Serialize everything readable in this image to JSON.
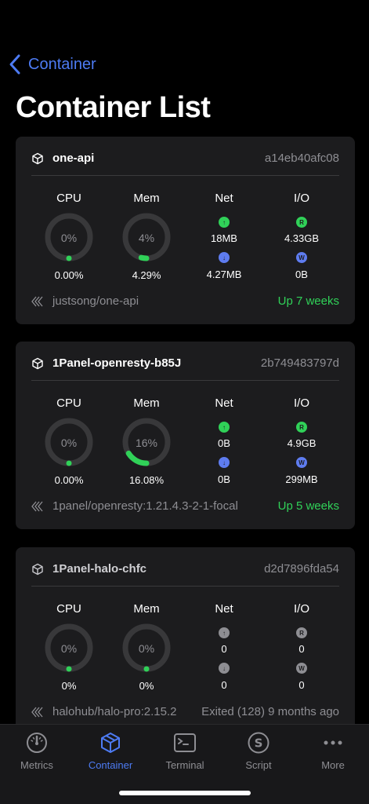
{
  "nav": {
    "back_label": "Container",
    "title": "Container List"
  },
  "column_labels": {
    "cpu": "CPU",
    "mem": "Mem",
    "net": "Net",
    "io": "I/O"
  },
  "io_badges": {
    "up": "↑",
    "down": "↓",
    "read": "R",
    "write": "W"
  },
  "colors": {
    "accent": "#4d7bf3",
    "green": "#30d158",
    "track": "#38383a",
    "muted": "#8e8e93",
    "up": "#30d158",
    "down": "#5e7cf0",
    "read": "#30d158",
    "write": "#5e7cf0",
    "inactive_badge": "#8e8e93"
  },
  "containers": [
    {
      "name": "one-api",
      "id": "a14eb40afc08",
      "cpu_pct_label": "0%",
      "cpu_fraction": 0.0,
      "cpu_value": "0.00%",
      "mem_pct_label": "4%",
      "mem_fraction": 0.04,
      "mem_value": "4.29%",
      "net_up": "18MB",
      "net_down": "4.27MB",
      "io_read": "4.33GB",
      "io_write": "0B",
      "image": "justsong/one-api",
      "status": "Up 7 weeks",
      "status_color": "#30d158",
      "active": true
    },
    {
      "name": "1Panel-openresty-b85J",
      "id": "2b749483797d",
      "cpu_pct_label": "0%",
      "cpu_fraction": 0.0,
      "cpu_value": "0.00%",
      "mem_pct_label": "16%",
      "mem_fraction": 0.16,
      "mem_value": "16.08%",
      "net_up": "0B",
      "net_down": "0B",
      "io_read": "4.9GB",
      "io_write": "299MB",
      "image": "1panel/openresty:1.21.4.3-2-1-focal",
      "status": "Up 5 weeks",
      "status_color": "#30d158",
      "active": true
    },
    {
      "name": "1Panel-halo-chfc",
      "id": "d2d7896fda54",
      "cpu_pct_label": "0%",
      "cpu_fraction": 0.0,
      "cpu_value": "0%",
      "mem_pct_label": "0%",
      "mem_fraction": 0.0,
      "mem_value": "0%",
      "net_up": "0",
      "net_down": "0",
      "io_read": "0",
      "io_write": "0",
      "image": "halohub/halo-pro:2.15.2",
      "status": "Exited (128) 9 months ago",
      "status_color": "#8e8e93",
      "active": false
    }
  ],
  "tabbar": {
    "items": [
      {
        "label": "Metrics",
        "icon": "gauge-icon"
      },
      {
        "label": "Container",
        "icon": "cube-icon"
      },
      {
        "label": "Terminal",
        "icon": "terminal-icon"
      },
      {
        "label": "Script",
        "icon": "script-icon"
      },
      {
        "label": "More",
        "icon": "more-icon"
      }
    ],
    "active_index": 1
  }
}
